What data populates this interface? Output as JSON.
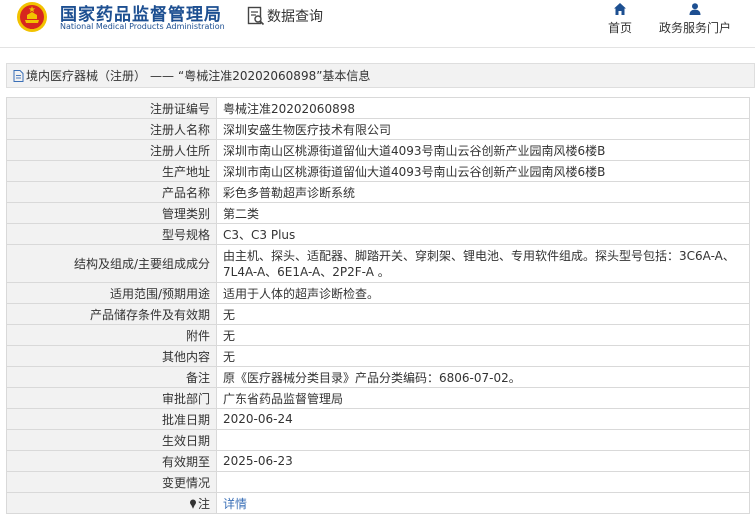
{
  "header": {
    "brand_cn": "国家药品监督管理局",
    "brand_en": "National Medical Products Administration",
    "query_label": "数据查询",
    "nav": [
      {
        "label": "首页",
        "icon": "home-icon"
      },
      {
        "label": "政务服务门户",
        "icon": "user-icon"
      }
    ]
  },
  "breadcrumb": {
    "section": "境内医疗器械（注册）",
    "separator": "——",
    "record": "“粤械注准20202060898”基本信息"
  },
  "detail": {
    "rows": [
      {
        "label": "注册证编号",
        "value": "粤械注准20202060898"
      },
      {
        "label": "注册人名称",
        "value": "深圳安盛生物医疗技术有限公司"
      },
      {
        "label": "注册人住所",
        "value": "深圳市南山区桃源街道留仙大道4093号南山云谷创新产业园南风楼6楼B"
      },
      {
        "label": "生产地址",
        "value": "深圳市南山区桃源街道留仙大道4093号南山云谷创新产业园南风楼6楼B"
      },
      {
        "label": "产品名称",
        "value": "彩色多普勒超声诊断系统"
      },
      {
        "label": "管理类别",
        "value": "第二类"
      },
      {
        "label": "型号规格",
        "value": "C3、C3 Plus"
      },
      {
        "label": "结构及组成/主要组成成分",
        "value": "由主机、探头、适配器、脚踏开关、穿刺架、锂电池、专用软件组成。探头型号包括：3C6A-A、7L4A-A、6E1A-A、2P2F-A 。"
      },
      {
        "label": "适用范围/预期用途",
        "value": "适用于人体的超声诊断检查。"
      },
      {
        "label": "产品储存条件及有效期",
        "value": "无"
      },
      {
        "label": "附件",
        "value": "无"
      },
      {
        "label": "其他内容",
        "value": "无"
      },
      {
        "label": "备注",
        "value": "原《医疗器械分类目录》产品分类编码：6806-07-02。"
      },
      {
        "label": "审批部门",
        "value": "广东省药品监督管理局"
      },
      {
        "label": "批准日期",
        "value": "2020-06-24"
      },
      {
        "label": "生效日期",
        "value": ""
      },
      {
        "label": "有效期至",
        "value": "2025-06-23"
      },
      {
        "label": "变更情况",
        "value": ""
      },
      {
        "label": "注",
        "value": "详情"
      }
    ]
  },
  "colors": {
    "brand_blue": "#1d4f91",
    "emblem_red": "#d7261e",
    "emblem_gold": "#f2c200",
    "label_bg": "#f2f2f2",
    "border": "#d9d9d9",
    "link": "#3a6fb7"
  }
}
